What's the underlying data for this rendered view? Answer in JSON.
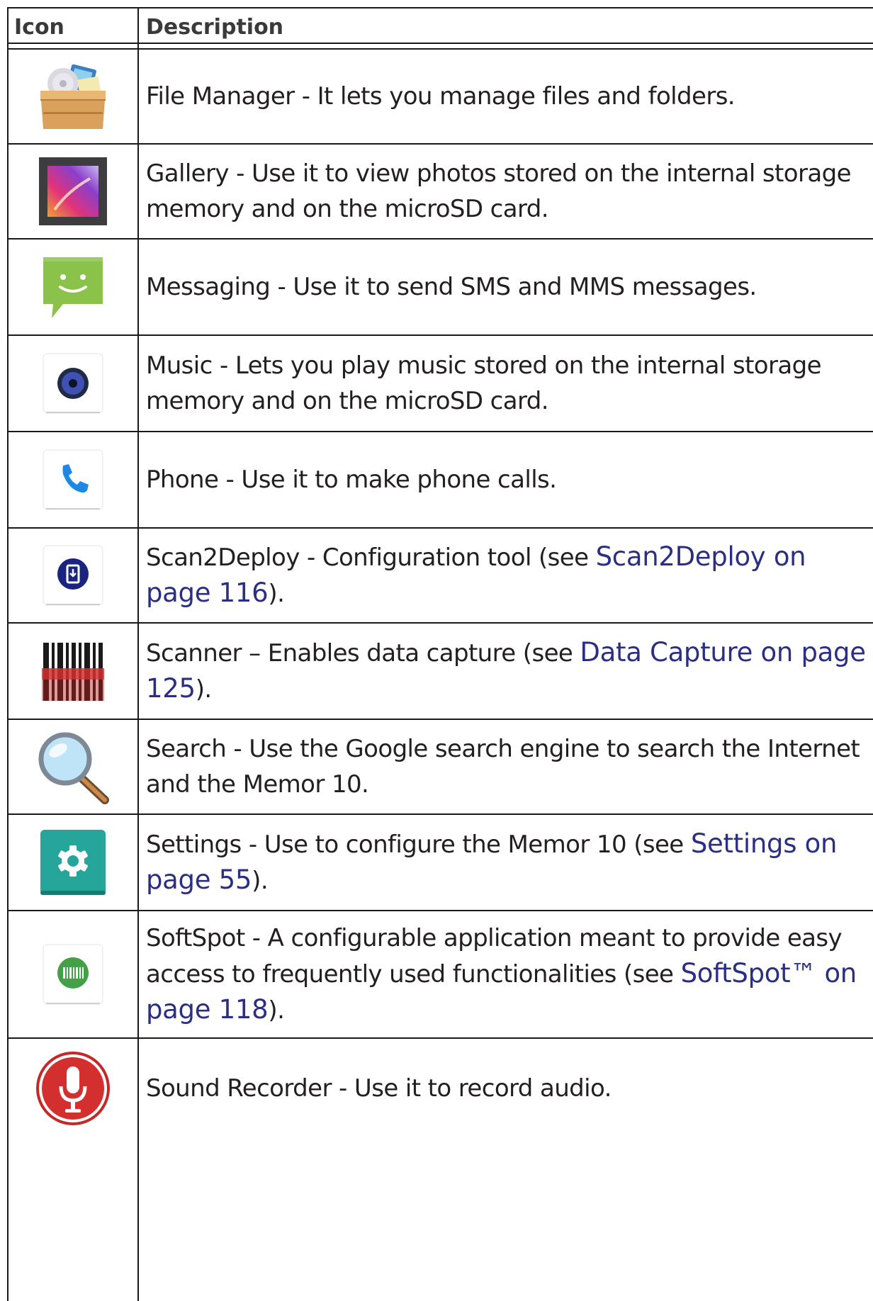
{
  "table": {
    "headers": {
      "icon": "Icon",
      "description": "Description"
    },
    "rows": [
      {
        "icon": "file-manager-icon",
        "text": "File Manager - It lets you manage files and folders.",
        "link": "",
        "after": ""
      },
      {
        "icon": "gallery-icon",
        "text": "Gallery - Use it to view photos stored on the internal storage memory and on the microSD card.",
        "link": "",
        "after": ""
      },
      {
        "icon": "messaging-icon",
        "text": "Messaging - Use it to send SMS and MMS messages.",
        "link": "",
        "after": ""
      },
      {
        "icon": "music-icon",
        "text": "Music - Lets you play music stored on the internal storage memory and on the microSD card.",
        "link": "",
        "after": ""
      },
      {
        "icon": "phone-icon",
        "text": "Phone - Use it to make phone calls.",
        "link": "",
        "after": ""
      },
      {
        "icon": "scan2deploy-icon",
        "text": "Scan2Deploy - Configuration tool (see ",
        "link": "Scan2Deploy on page 116",
        "after": ")."
      },
      {
        "icon": "scanner-icon",
        "text": "Scanner – Enables data capture (see ",
        "link": "Data Capture on page 125",
        "after": ")."
      },
      {
        "icon": "search-icon",
        "text": "Search - Use the Google search engine to search the Internet and the Memor 10.",
        "link": "",
        "after": ""
      },
      {
        "icon": "settings-icon",
        "text": "Settings - Use to configure the Memor 10 (see ",
        "link": "Settings on page 55",
        "after": ")."
      },
      {
        "icon": "softspot-icon",
        "text": "SoftSpot - A configurable application meant to provide easy access to frequently used functionalities (see ",
        "link": "SoftSpot™ on page 118",
        "after": ")."
      },
      {
        "icon": "sound-recorder-icon",
        "text": "Sound Recorder - Use it to record audio.",
        "link": "",
        "after": ""
      }
    ]
  }
}
